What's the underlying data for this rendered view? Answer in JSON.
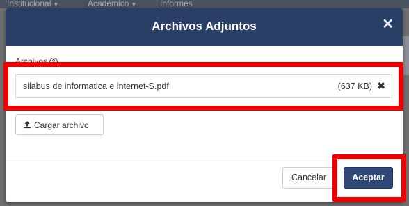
{
  "navbar": {
    "items": [
      {
        "label": "Institucional"
      },
      {
        "label": "Académico"
      },
      {
        "label": "Informes"
      }
    ]
  },
  "modal": {
    "title": "Archivos Adjuntos",
    "field_label": "Archivos",
    "attachments": [
      {
        "file_name": "silabus de informatica e internet-S.pdf",
        "size": "(637 KB)"
      }
    ],
    "upload_label": "Cargar archivo",
    "cancel_label": "Cancelar",
    "accept_label": "Aceptar"
  },
  "icons": {
    "close": "close-icon",
    "help": "help-circle-icon",
    "remove": "remove-icon",
    "upload": "upload-icon"
  },
  "colors": {
    "header": "#2a3f66",
    "accept_button": "#2f4777",
    "highlight": "#f00000"
  }
}
